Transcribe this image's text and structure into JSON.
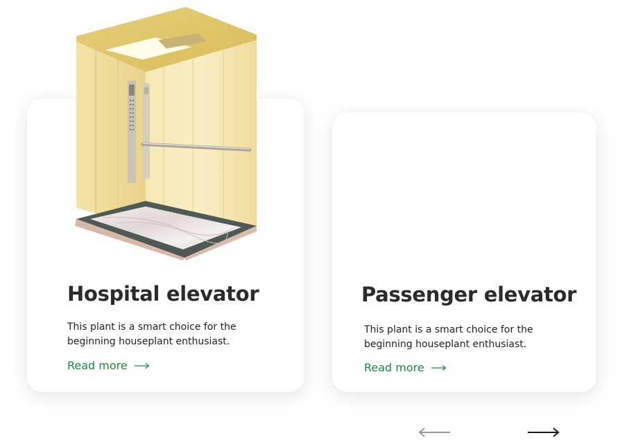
{
  "cards": [
    {
      "title": "Hospital elevator",
      "description": "This plant is a smart choice for the beginning houseplant enthusiast.",
      "link_label": "Read more",
      "image": "elevator-cabin-image"
    },
    {
      "title": "Passenger elevator",
      "description": "This plant is a smart choice for the beginning houseplant enthusiast.",
      "link_label": "Read more"
    }
  ],
  "navigation": {
    "prev_icon": "arrow-left-icon",
    "next_icon": "arrow-right-icon"
  },
  "colors": {
    "accent": "#1e8a3c",
    "title": "#2b2b2b",
    "text": "#222222",
    "prev_arrow": "#9a9a9a",
    "next_arrow": "#1a1a1a"
  }
}
